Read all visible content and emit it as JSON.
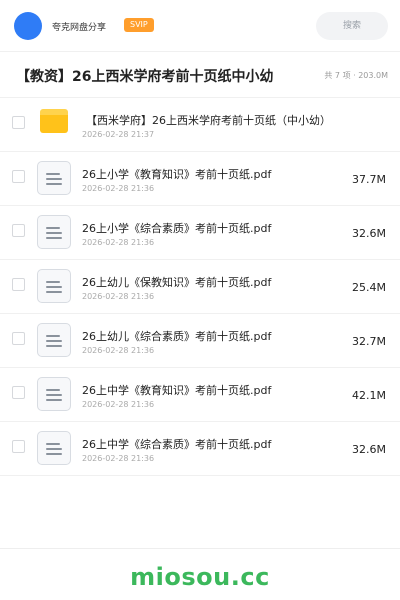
{
  "header": {
    "sharer_name": "夸克网盘分享",
    "badge": "SVIP",
    "search_label": "搜索"
  },
  "share": {
    "title": "【教资】26上西米学府考前十页纸中小幼",
    "summary": "共 7 项 · 203.0M"
  },
  "items": [
    {
      "type": "folder",
      "name": "【西米学府】26上西米学府考前十页纸（中小幼）",
      "date": "2026-02-28 21:37",
      "size": ""
    },
    {
      "type": "file",
      "name": "26上小学《教育知识》考前十页纸.pdf",
      "date": "2026-02-28 21:36",
      "size": "37.7M"
    },
    {
      "type": "file",
      "name": "26上小学《综合素质》考前十页纸.pdf",
      "date": "2026-02-28 21:36",
      "size": "32.6M"
    },
    {
      "type": "file",
      "name": "26上幼儿《保教知识》考前十页纸.pdf",
      "date": "2026-02-28 21:36",
      "size": "25.4M"
    },
    {
      "type": "file",
      "name": "26上幼儿《综合素质》考前十页纸.pdf",
      "date": "2026-02-28 21:36",
      "size": "32.7M"
    },
    {
      "type": "file",
      "name": "26上中学《教育知识》考前十页纸.pdf",
      "date": "2026-02-28 21:36",
      "size": "42.1M"
    },
    {
      "type": "file",
      "name": "26上中学《综合素质》考前十页纸.pdf",
      "date": "2026-02-28 21:36",
      "size": "32.6M"
    }
  ],
  "footer": {
    "watermark": "miosou.cc"
  },
  "colors": {
    "avatar": "#2f7cf6",
    "svip_badge": "#ff9e2c",
    "folder": "#ffc21a",
    "watermark": "#3cb85c"
  },
  "icons": {
    "avatar": "user-avatar-circle",
    "folder": "folder-icon",
    "file": "document-icon"
  }
}
